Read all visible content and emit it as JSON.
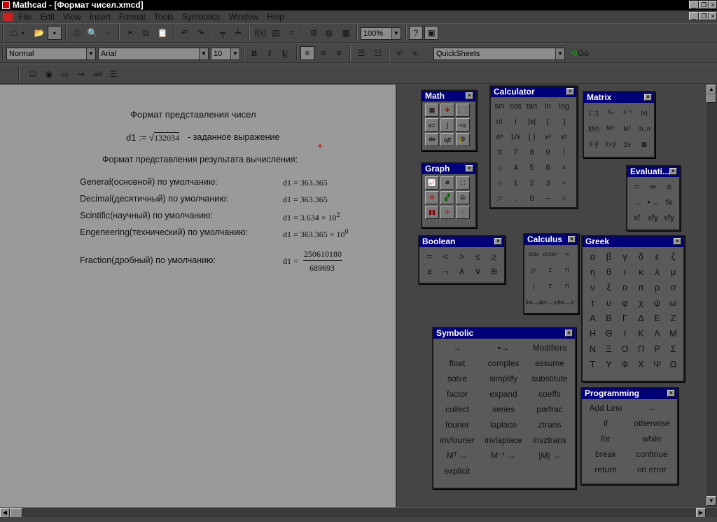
{
  "window": {
    "title": "Mathcad - [Формат чисел.xmcd]"
  },
  "menu": [
    "File",
    "Edit",
    "View",
    "Insert",
    "Format",
    "Tools",
    "Symbolics",
    "Window",
    "Help"
  ],
  "toolbar": {
    "zoom": "100%"
  },
  "format_bar": {
    "style": "Normal",
    "font": "Arial",
    "size": "10",
    "bold": "B",
    "italic": "I",
    "underline": "U",
    "quicksheets": "QuickSheets",
    "go": "Go"
  },
  "doc": {
    "heading": "Формат представления чисел",
    "def_lhs": "d1",
    "def_op": ":=",
    "def_radicand": "132034",
    "def_comment": "- заданное выражение",
    "subheading": "Формат представления результата вычисления:",
    "rows": [
      {
        "label": "General(основной) по умолчанию:",
        "result": "d1 = 363.365",
        "exp": ""
      },
      {
        "label": "Decimal(десятичный) по умолчанию:",
        "result": "d1 = 363.365",
        "exp": ""
      },
      {
        "label": "Scintific(научный) по умолчанию:",
        "result": "d1 = 3.634 × 10",
        "exp": "2"
      },
      {
        "label": "Engeneering(технический) по умолчанию:",
        "result": "d1 = 363.365 × 10",
        "exp": "0"
      }
    ],
    "fraction_label": "Fraction(дробный) по умолчанию:",
    "fraction_lhs": "d1 =",
    "fraction_num": "250610180",
    "fraction_den": "689693",
    "cursor": "+"
  },
  "palettes": {
    "math": {
      "title": "Math"
    },
    "graph": {
      "title": "Graph"
    },
    "calculator": {
      "title": "Calculator",
      "cells": [
        "sin",
        "cos",
        "tan",
        "ln",
        "log",
        "n!",
        "i",
        "|x|",
        "⌈",
        "⌉",
        "eˣ",
        "1/x",
        "( )",
        "x²",
        "xʸ",
        "π",
        "7",
        "8",
        "9",
        "/",
        "⁝⁝",
        "4",
        "5",
        "6",
        "×",
        "÷",
        "1",
        "2",
        "3",
        "+",
        ":=",
        ".",
        "0",
        "−",
        "="
      ]
    },
    "matrix": {
      "title": "Matrix",
      "cells": [
        "[:::]",
        "Xₙ",
        "x⁻¹",
        "|x|",
        "f(M)",
        "M⁽⁾",
        "Mᵀ",
        "m..n",
        "x⃗·y⃗",
        "x⃗×y⃗",
        "Σv",
        "▦"
      ]
    },
    "evaluation": {
      "title": "Evaluati...",
      "cells": [
        "=",
        "≔",
        "≡",
        "→",
        "•→",
        "fx",
        "xf",
        "xfy",
        "xfy"
      ]
    },
    "boolean": {
      "title": "Boolean",
      "cells": [
        "=",
        "<",
        ">",
        "≤",
        "≥",
        "≠",
        "¬",
        "∧",
        "∨",
        "⊕"
      ]
    },
    "calculus": {
      "title": "Calculus",
      "cells": [
        "d/dx",
        "dⁿ/dxⁿ",
        "∞",
        "∫ₐᵇ",
        "Σ",
        "Π",
        "∫",
        "Σ",
        "Π",
        "lim→a",
        "lim→a⁺",
        "lim→a⁻"
      ]
    },
    "greek": {
      "title": "Greek",
      "cells": [
        "α",
        "β",
        "γ",
        "δ",
        "ε",
        "ζ",
        "η",
        "θ",
        "ι",
        "κ",
        "λ",
        "μ",
        "ν",
        "ξ",
        "ο",
        "π",
        "ρ",
        "σ",
        "τ",
        "υ",
        "φ",
        "χ",
        "ψ",
        "ω",
        "Α",
        "Β",
        "Γ",
        "Δ",
        "Ε",
        "Ζ",
        "Η",
        "Θ",
        "Ι",
        "Κ",
        "Λ",
        "Μ",
        "Ν",
        "Ξ",
        "Ο",
        "Π",
        "Ρ",
        "Σ",
        "Τ",
        "Υ",
        "Φ",
        "Χ",
        "Ψ",
        "Ω"
      ]
    },
    "symbolic": {
      "title": "Symbolic",
      "cells": [
        "→",
        "▪→",
        "Modifiers",
        "float",
        "complex",
        "assume",
        "solve",
        "simplify",
        "substitute",
        "factor",
        "expand",
        "coeffs",
        "collect",
        "series",
        "parfrac",
        "fourier",
        "laplace",
        "ztrans",
        "invfourier",
        "invlaplace",
        "invztrans",
        "Mᵀ →",
        "M⁻¹ →",
        "|M| →",
        "explicit",
        "",
        ""
      ]
    },
    "programming": {
      "title": "Programming",
      "cells": [
        "Add Line",
        "←",
        "if",
        "otherwise",
        "for",
        "while",
        "break",
        "continue",
        "return",
        "on error"
      ]
    }
  }
}
